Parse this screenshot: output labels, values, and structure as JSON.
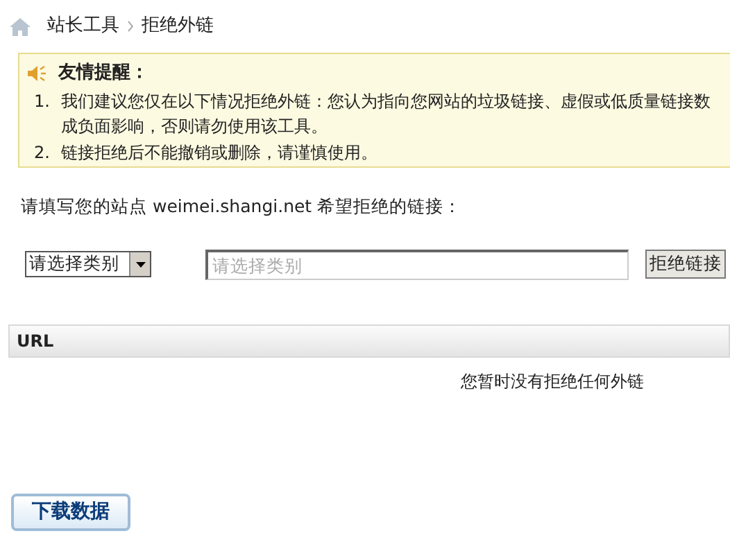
{
  "breadcrumb": [
    {
      "label": "站长工具"
    },
    {
      "label": "拒绝外链"
    }
  ],
  "notice": {
    "title": "友情提醒：",
    "items": [
      {
        "marker": "1.",
        "lines": [
          "我们建议您仅在以下情况拒绝外链：您认为指向您网站的垃圾链接、虚假或低质量链接数",
          "成负面影响，否则请勿使用该工具。"
        ]
      },
      {
        "marker": "2.",
        "lines": [
          "链接拒绝后不能撤销或删除，请谨慎使用。"
        ]
      }
    ]
  },
  "prompt": "请填写您的站点 weimei.shangi.net 希望拒绝的链接：",
  "category_select": {
    "value": "请选择类别"
  },
  "link_field": {
    "placeholder": "请选择类别"
  },
  "reject_button": "拒绝链接",
  "table": {
    "columns": [
      "URL"
    ],
    "empty_message": "您暂时没有拒绝任何外链"
  },
  "download_button": "下载数据"
}
